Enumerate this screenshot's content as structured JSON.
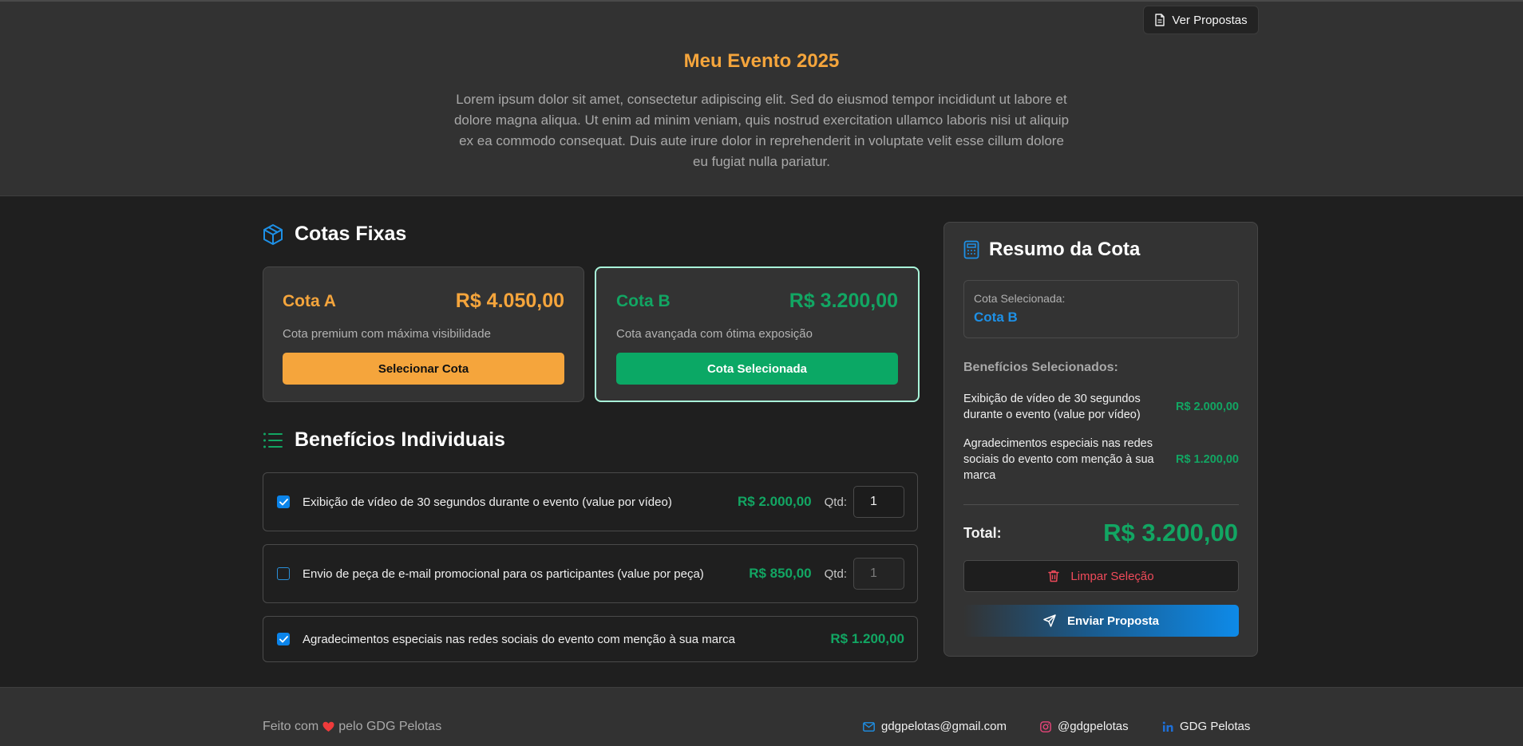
{
  "toolbar": {
    "view_proposals_label": "Ver Propostas"
  },
  "event": {
    "title": "Meu Evento 2025",
    "description": "Lorem ipsum dolor sit amet, consectetur adipiscing elit. Sed do eiusmod tempor incididunt ut labore et dolore magna aliqua. Ut enim ad minim veniam, quis nostrud exercitation ullamco laboris nisi ut aliquip ex ea commodo consequat. Duis aute irure dolor in reprehenderit in voluptate velit esse cillum dolore eu fugiat nulla pariatur."
  },
  "fixed_quotas": {
    "title": "Cotas Fixas",
    "cards": [
      {
        "name": "Cota A",
        "price": "R$ 4.050,00",
        "description": "Cota premium com máxima visibilidade",
        "button_label": "Selecionar Cota",
        "accent": "#f5a53c",
        "selected": false
      },
      {
        "name": "Cota B",
        "price": "R$ 3.200,00",
        "description": "Cota avançada com ótima exposição",
        "button_label": "Cota Selecionada",
        "accent": "#12a663",
        "selected": true
      }
    ]
  },
  "individual_benefits": {
    "title": "Benefícios Individuais",
    "qty_label": "Qtd:",
    "items": [
      {
        "label": "Exibição de vídeo de 30 segundos durante o evento (value por vídeo)",
        "price": "R$ 2.000,00",
        "checked": true,
        "has_qty": true,
        "qty": "1"
      },
      {
        "label": "Envio de peça de e-mail promocional para os participantes (value por peça)",
        "price": "R$ 850,00",
        "checked": false,
        "has_qty": true,
        "qty": "1"
      },
      {
        "label": "Agradecimentos especiais nas redes sociais do evento com menção à sua marca",
        "price": "R$ 1.200,00",
        "checked": true,
        "has_qty": false
      }
    ]
  },
  "summary": {
    "title": "Resumo da Cota",
    "selected_label": "Cota Selecionada:",
    "selected_value": "Cota B",
    "benefits_heading": "Benefícios Selecionados:",
    "benefits": [
      {
        "label": "Exibição de vídeo de 30 segundos durante o evento (value por vídeo)",
        "price": "R$ 2.000,00"
      },
      {
        "label": "Agradecimentos especiais nas redes sociais do evento com menção à sua marca",
        "price": "R$ 1.200,00"
      }
    ],
    "total_label": "Total:",
    "total_value": "R$ 3.200,00",
    "clear_label": "Limpar Seleção",
    "send_label": "Enviar Proposta"
  },
  "footer": {
    "made_with": "Feito com",
    "by": "pelo GDG Pelotas",
    "email": "gdgpelotas@gmail.com",
    "instagram": "@gdgpelotas",
    "linkedin": "GDG Pelotas"
  },
  "colors": {
    "orange": "#f5a53c",
    "green": "#12a663",
    "blue": "#0b84ea",
    "red": "#ef4a5a"
  }
}
